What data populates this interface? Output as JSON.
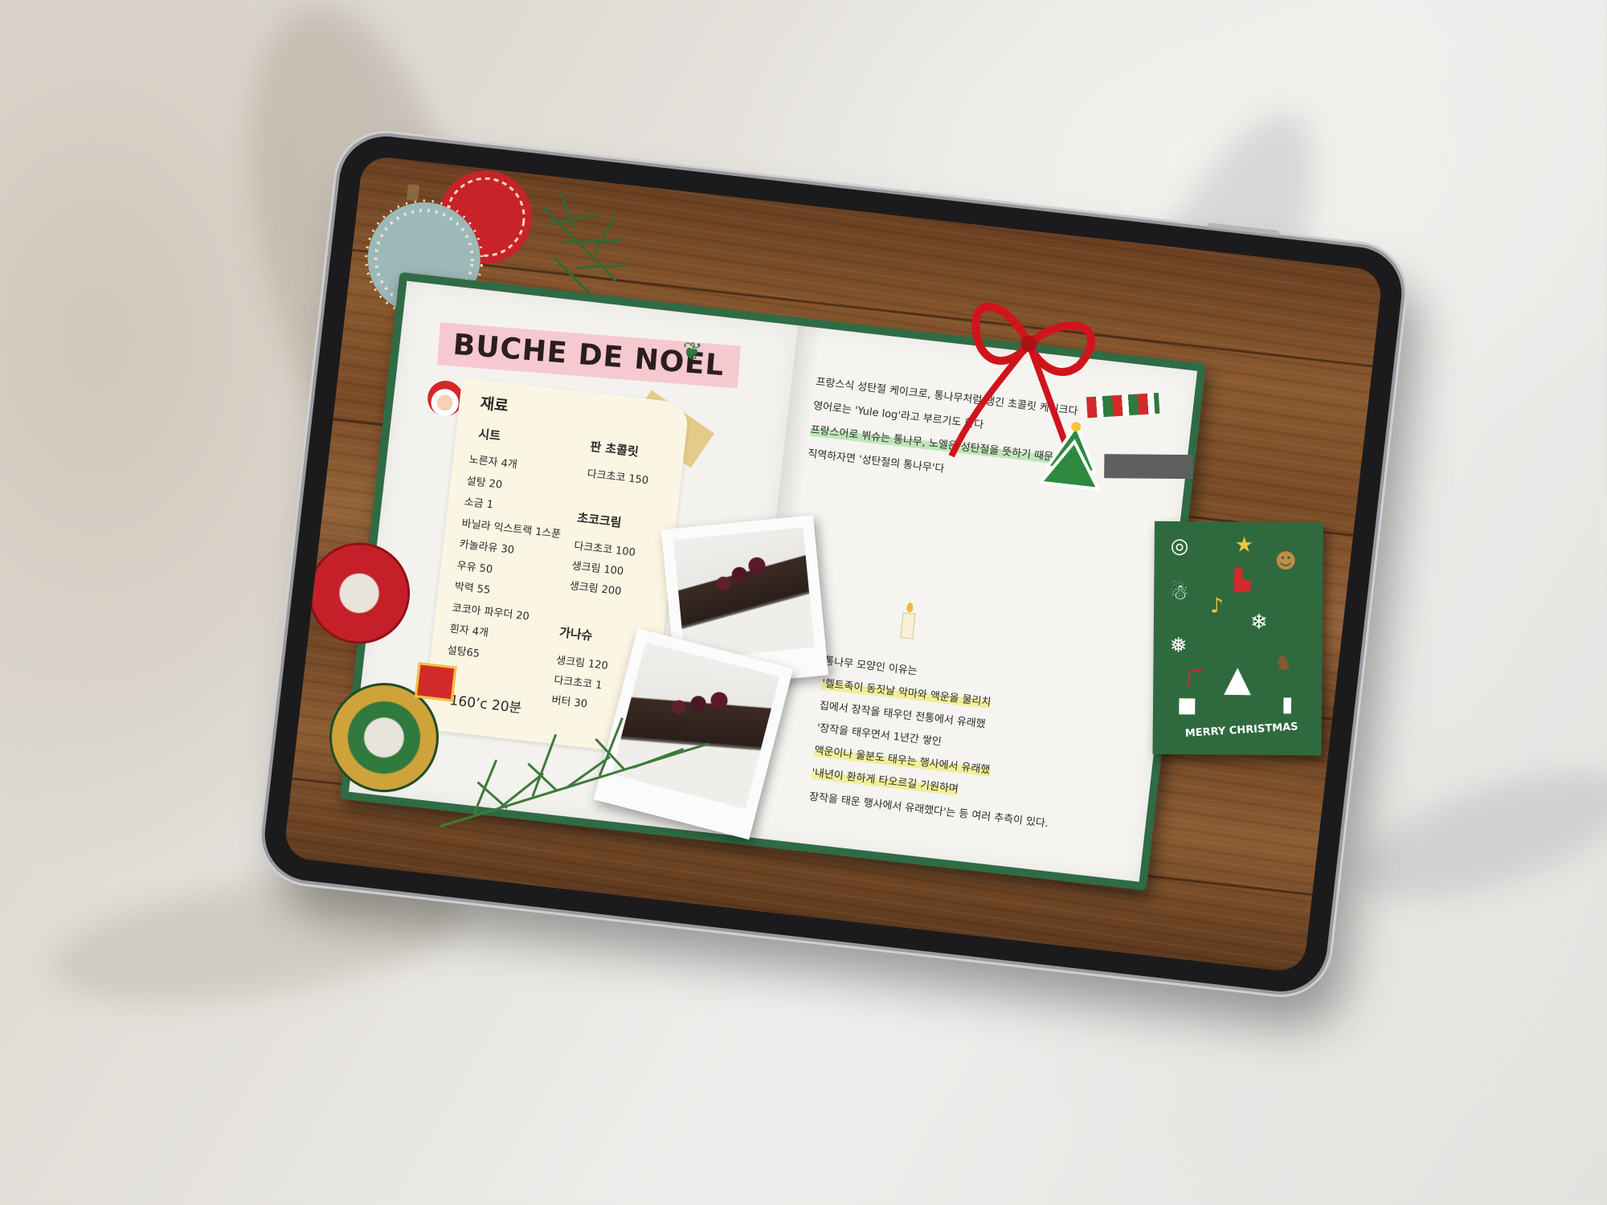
{
  "book": {
    "title": "BUCHE DE NOEL",
    "ingredients_heading": "재료",
    "sheet_heading": "시트",
    "sheet_items": [
      "노른자 4개",
      "설탕 20",
      "소금 1",
      "바닐라 익스트랙 1스푼",
      "카놀라유 30",
      "우유 50",
      "박력 55",
      "코코아 파우더 20",
      "흰자 4개",
      "설탕65"
    ],
    "plate_choc_heading": "판 초콜릿",
    "plate_choc_items": [
      "다크초코 150"
    ],
    "choc_cream_heading": "초코크림",
    "choc_cream_items": [
      "다크초코 100",
      "생크림 100",
      "생크림 200"
    ],
    "ganache_heading": "가나슈",
    "ganache_items": [
      "생크림 120",
      "다크초코 1",
      "버터 30"
    ],
    "bake": "160’c 20분",
    "desc_lines": [
      "프랑스식 성탄절 케이크로, 통나무처럼 생긴 초콜릿 케이크다",
      "영어로는 'Yule log'라고 부르기도 한다",
      "프랑스어로 뷔슈는 통나무, 노엘은 성탄절을 뜻하기 때문에",
      "직역하자면 '성탄절의 통나무'다"
    ],
    "origin_lines": [
      "통나무 모양인 이유는",
      "'켈트족이 동짓날 악마와 액운을 물리치",
      "집에서 장작을 태우던 전통에서 유래했",
      "'장작을 태우면서 1년간 쌓인",
      "액운이나 울분도 태우는 행사에서 유래했",
      "'내년이 환하게 타오르길 기원하며",
      "장작을 태운 행사에서 유래했다'는 등 여러 추측이 있다."
    ]
  },
  "stickers": {
    "label": "MERRY CHRISTMAS"
  },
  "colors": {
    "wood": "#7a4b26",
    "book_cover": "#2f6b45",
    "title_tag": "#f5c9cf",
    "note_paper": "#fbf5e3",
    "highlight_yellow": "#f1ee9b",
    "highlight_green": "#bfe6b9"
  }
}
